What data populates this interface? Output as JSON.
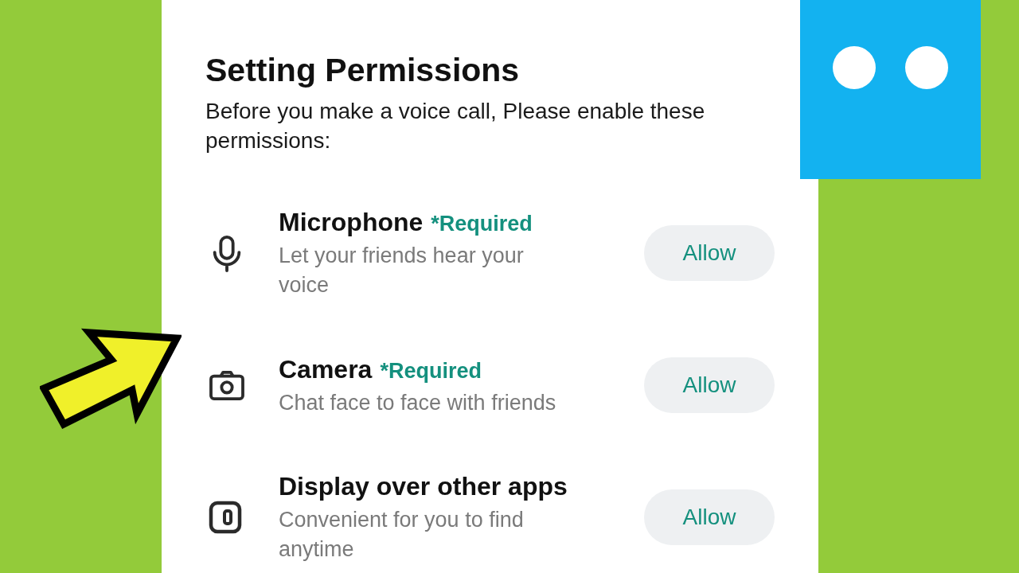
{
  "title": "Setting Permissions",
  "subtitle": "Before you make a voice call, Please enable these permissions:",
  "permissions": [
    {
      "kind": "microphone",
      "name": "Microphone",
      "badge": "*Required",
      "description": "Let your friends hear your voice",
      "button": "Allow"
    },
    {
      "kind": "camera",
      "name": "Camera",
      "badge": "*Required",
      "description": "Chat face to face with friends",
      "button": "Allow"
    },
    {
      "kind": "overlay",
      "name": "Display over other apps",
      "description": "Convenient for you to find anytime",
      "button": "Allow"
    }
  ]
}
